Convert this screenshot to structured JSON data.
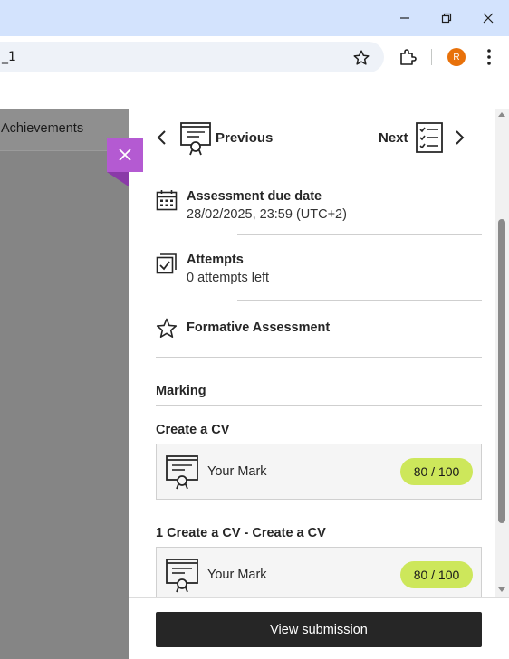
{
  "browser": {
    "address_text": "_1",
    "profile_initial": "R"
  },
  "left": {
    "tab_label": "Achievements"
  },
  "panel": {
    "nav": {
      "previous_label": "Previous",
      "next_label": "Next"
    },
    "details": [
      {
        "title": "Assessment due date",
        "subtitle": "28/02/2025, 23:59 (UTC+2)",
        "icon": "calendar-icon"
      },
      {
        "title": "Attempts",
        "subtitle": "0 attempts left",
        "icon": "checkbox-stack-icon"
      },
      {
        "title": "Formative Assessment",
        "subtitle": "",
        "icon": "star-icon"
      }
    ],
    "marking": {
      "heading": "Marking",
      "items": [
        {
          "title": "Create a CV",
          "label": "Your Mark",
          "score": "80 / 100"
        },
        {
          "title": "1 Create a CV - Create a CV",
          "label": "Your Mark",
          "score": "80 / 100"
        }
      ]
    },
    "footer": {
      "button_label": "View submission"
    }
  },
  "colors": {
    "accent_close": "#b45ad2",
    "score_badge": "#cde75b",
    "button_dark": "#262626",
    "browser_titlebar": "#d3e3fd"
  }
}
